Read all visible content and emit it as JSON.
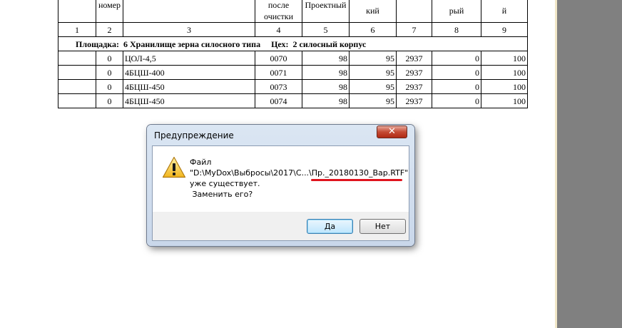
{
  "table": {
    "header_partials": {
      "c2": "номер",
      "c4_line1": "после",
      "c4_line2": "очистки",
      "c5": "Проектный",
      "c6": "кий",
      "c8": "рый",
      "c9": "й"
    },
    "column_numbers": [
      "1",
      "2",
      "3",
      "4",
      "5",
      "6",
      "7",
      "8",
      "9"
    ],
    "group_row": "Площадка:  6 Хранилище зерна силосного типа     Цех:  2 силосный корпус",
    "rows": [
      {
        "c2": "0",
        "c3": "ЦОЛ-4,5",
        "c4": "0070",
        "c5": "98",
        "c6": "95",
        "c7": "2937",
        "c8": "0",
        "c9": "100"
      },
      {
        "c2": "0",
        "c3": "4БЦШ-400",
        "c4": "0071",
        "c5": "98",
        "c6": "95",
        "c7": "2937",
        "c8": "0",
        "c9": "100"
      },
      {
        "c2": "0",
        "c3": "4БЦШ-450",
        "c4": "0073",
        "c5": "98",
        "c6": "95",
        "c7": "2937",
        "c8": "0",
        "c9": "100"
      },
      {
        "c2": "0",
        "c3": "4БЦШ-450",
        "c4": "0074",
        "c5": "98",
        "c6": "95",
        "c7": "2937",
        "c8": "0",
        "c9": "100"
      }
    ]
  },
  "dialog": {
    "title": "Предупреждение",
    "close_glyph": "✕",
    "icon": "warning-icon",
    "line1": "Файл",
    "line2": "\"D:\\MyDox\\Выбросы\\2017\\C...\\Пр._20180130_Вар.RTF\"",
    "line3": "уже существует.",
    "line4": " Заменить его?",
    "yes_label": "Да",
    "no_label": "Нет",
    "highlight_color": "#e0141e"
  }
}
